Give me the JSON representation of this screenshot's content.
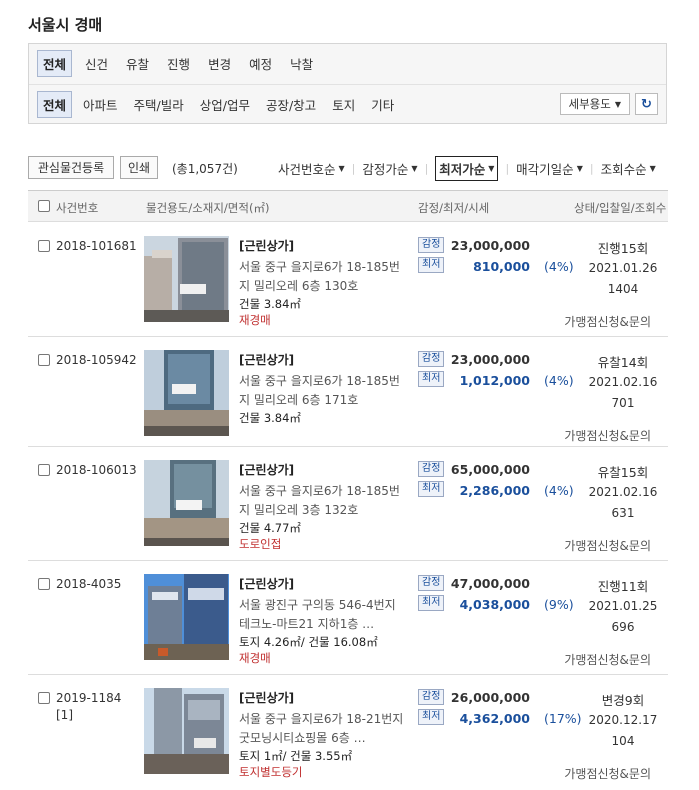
{
  "page": {
    "title": "서울시 경매"
  },
  "filters": {
    "status_tabs": [
      "전체",
      "신건",
      "유찰",
      "진행",
      "변경",
      "예정",
      "낙찰"
    ],
    "type_tabs": [
      "전체",
      "아파트",
      "주택/빌라",
      "상업/업무",
      "공장/창고",
      "토지",
      "기타"
    ],
    "detail_use_label": "세부용도",
    "refresh_icon": "refresh-icon"
  },
  "toolbar": {
    "interest_label": "관심물건등록",
    "print_label": "인쇄",
    "total_label": "(총1,057건)",
    "sorts": [
      "사건번호순",
      "감정가순",
      "최저가순",
      "매각기일순",
      "조회수순"
    ]
  },
  "table": {
    "headers": {
      "case": "사건번호",
      "item": "물건용도/소재지/면적(㎡)",
      "price": "감정/최저/시세",
      "status": "상태/입찰일/조회수"
    }
  },
  "rows": [
    {
      "case_no": "2018-101681",
      "case_sub": "",
      "name": "[근린상가]",
      "address": "서울 중구 을지로6가 18-185번지 밀리오레 6층 130호",
      "area": "건물 3.84㎡",
      "note": "재경매",
      "badge_appraisal": "감정",
      "badge_min": "최저",
      "appraisal": "23,000,000",
      "min_price": "810,000",
      "percent": "(4%)",
      "status": "진행15회",
      "date": "2021.01.26",
      "views": "1404",
      "apply": "가맹점신청&문의"
    },
    {
      "case_no": "2018-105942",
      "case_sub": "",
      "name": "[근린상가]",
      "address": "서울 중구 을지로6가 18-185번지 밀리오레 6층 171호",
      "area": "건물 3.84㎡",
      "note": "",
      "badge_appraisal": "감정",
      "badge_min": "최저",
      "appraisal": "23,000,000",
      "min_price": "1,012,000",
      "percent": "(4%)",
      "status": "유찰14회",
      "date": "2021.02.16",
      "views": "701",
      "apply": "가맹점신청&문의"
    },
    {
      "case_no": "2018-106013",
      "case_sub": "",
      "name": "[근린상가]",
      "address": "서울 중구 을지로6가 18-185번지 밀리오레 3층 132호",
      "area": "건물 4.77㎡",
      "note": "도로인접",
      "badge_appraisal": "감정",
      "badge_min": "최저",
      "appraisal": "65,000,000",
      "min_price": "2,286,000",
      "percent": "(4%)",
      "status": "유찰15회",
      "date": "2021.02.16",
      "views": "631",
      "apply": "가맹점신청&문의"
    },
    {
      "case_no": "2018-4035",
      "case_sub": "",
      "name": "[근린상가]",
      "address": "서울 광진구 구의동 546-4번지 테크노-마트21 지하1층 …",
      "area": "토지 4.26㎡/ 건물 16.08㎡",
      "note": "재경매",
      "badge_appraisal": "감정",
      "badge_min": "최저",
      "appraisal": "47,000,000",
      "min_price": "4,038,000",
      "percent": "(9%)",
      "status": "진행11회",
      "date": "2021.01.25",
      "views": "696",
      "apply": "가맹점신청&문의"
    },
    {
      "case_no": "2019-1184",
      "case_sub": "[1]",
      "name": "[근린상가]",
      "address": "서울 중구 을지로6가 18-21번지 굿모닝시티쇼핑몰 6층 …",
      "area": "토지 1㎡/ 건물 3.55㎡",
      "note": "토지별도등기",
      "badge_appraisal": "감정",
      "badge_min": "최저",
      "appraisal": "26,000,000",
      "min_price": "4,362,000",
      "percent": "(17%)",
      "status": "변경9회",
      "date": "2020.12.17",
      "views": "104",
      "apply": "가맹점신청&문의"
    }
  ]
}
